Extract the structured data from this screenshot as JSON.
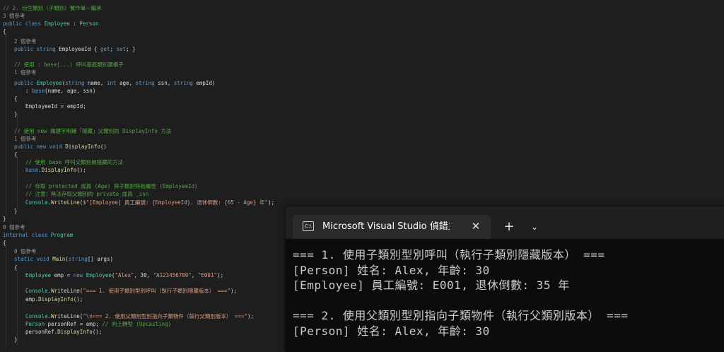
{
  "editor": {
    "lines": [
      {
        "text": "// 2. 衍生類別（子類別）實作單一繼承",
        "kind": "comment"
      },
      {
        "text": "3 個參考",
        "kind": "ref"
      },
      {
        "text": "public class Employee : Person",
        "kind": "code"
      },
      {
        "text": "{",
        "kind": "code"
      },
      {
        "text": "2 個參考",
        "kind": "ref"
      },
      {
        "text": "public string EmployeeId { get; set; }",
        "kind": "code"
      },
      {
        "text": "",
        "kind": "code"
      },
      {
        "text": "// 使用 : base(...) 呼叫基底類別建構子",
        "kind": "comment"
      },
      {
        "text": "1 個參考",
        "kind": "ref"
      },
      {
        "text": "public Employee(string name, int age, string ssn, string empId)",
        "kind": "code"
      },
      {
        "text": ": base(name, age, ssn)",
        "kind": "code"
      },
      {
        "text": "{",
        "kind": "code"
      },
      {
        "text": "EmployeeId = empId;",
        "kind": "code"
      },
      {
        "text": "}",
        "kind": "code"
      },
      {
        "text": "",
        "kind": "code"
      },
      {
        "text": "// 使用 new 關鍵字明確「隱藏」父類別的 DisplayInfo 方法",
        "kind": "comment"
      },
      {
        "text": "1 個參考",
        "kind": "ref"
      },
      {
        "text": "public new void DisplayInfo()",
        "kind": "code"
      },
      {
        "text": "{",
        "kind": "code"
      },
      {
        "text": "// 使用 base 呼叫父類別被隱藏的方法",
        "kind": "comment"
      },
      {
        "text": "base.DisplayInfo();",
        "kind": "code"
      },
      {
        "text": "",
        "kind": "code"
      },
      {
        "text": "// 存取 protected 成員 (Age) 與子類別特有屬性 (EmployeeId)",
        "kind": "comment"
      },
      {
        "text": "// 注意：無法存取父類別的 private 成員 _ssn",
        "kind": "comment"
      },
      {
        "text": "Console.WriteLine($\"[Employee] 員工編號: {EmployeeId}, 退休倒數: {65 - Age} 年\");",
        "kind": "code"
      },
      {
        "text": "}",
        "kind": "code"
      },
      {
        "text": "}",
        "kind": "code"
      },
      {
        "text": "0 個參考",
        "kind": "ref"
      },
      {
        "text": "internal class Program",
        "kind": "code"
      },
      {
        "text": "{",
        "kind": "code"
      },
      {
        "text": "0 個參考",
        "kind": "ref"
      },
      {
        "text": "static void Main(string[] args)",
        "kind": "code"
      },
      {
        "text": "{",
        "kind": "code"
      },
      {
        "text": "Employee emp = new Employee(\"Alex\", 30, \"A123456789\", \"E001\");",
        "kind": "code"
      },
      {
        "text": "",
        "kind": "code"
      },
      {
        "text": "Console.WriteLine(\"=== 1. 使用子類別型別呼叫（執行子類別隱藏版本） ===\");",
        "kind": "code"
      },
      {
        "text": "emp.DisplayInfo();",
        "kind": "code"
      },
      {
        "text": "",
        "kind": "code"
      },
      {
        "text": "Console.WriteLine(\"\\n=== 2. 使用父類別型別指向子類物件（執行父類別版本） ===\");",
        "kind": "code"
      },
      {
        "text": "Person personRef = emp; // 向上轉型 (Upcasting)",
        "kind": "code"
      },
      {
        "text": "personRef.DisplayInfo();",
        "kind": "code"
      },
      {
        "text": "}",
        "kind": "code"
      }
    ]
  },
  "terminal": {
    "icon": "console-icon",
    "icon_glyph": "C:\\",
    "tab_title": "Microsoft Visual Studio 偵錯主",
    "close_glyph": "✕",
    "new_tab_glyph": "+",
    "menu_glyph": "⌄",
    "output": [
      "=== 1. 使用子類別型別呼叫（執行子類別隱藏版本） ===",
      "[Person] 姓名: Alex, 年齡: 30",
      "[Employee] 員工編號: E001, 退休倒數: 35 年",
      "",
      "=== 2. 使用父類別型別指向子類物件（執行父類別版本） ===",
      "[Person] 姓名: Alex, 年齡: 30"
    ]
  }
}
